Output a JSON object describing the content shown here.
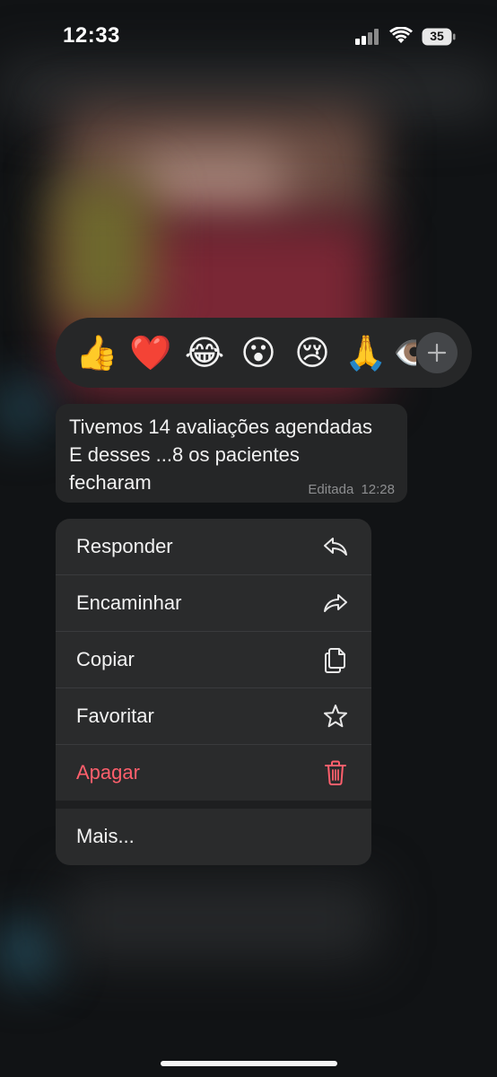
{
  "status_bar": {
    "time": "12:33",
    "battery": "35"
  },
  "reactions": {
    "items": [
      {
        "emoji": "👍",
        "name": "thumbs-up"
      },
      {
        "emoji": "❤️",
        "name": "heart"
      },
      {
        "emoji": "😂",
        "name": "laughing"
      },
      {
        "emoji": "😮",
        "name": "surprised"
      },
      {
        "emoji": "😢",
        "name": "crying"
      },
      {
        "emoji": "🙏",
        "name": "pray"
      },
      {
        "emoji": "👁️",
        "name": "eye"
      }
    ],
    "more_icon": "plus-icon"
  },
  "message": {
    "text": "Tivemos 14 avaliações agendadas\nE desses ...8 os pacientes\nfecharam",
    "status": "Editada",
    "time": "12:28"
  },
  "menu": {
    "reply": "Responder",
    "forward": "Encaminhar",
    "copy": "Copiar",
    "star": "Favoritar",
    "delete": "Apagar",
    "more": "Mais..."
  },
  "colors": {
    "menu_bg": "#2a2b2c",
    "danger": "#ff5f6c",
    "bubble_bg": "#252627"
  }
}
